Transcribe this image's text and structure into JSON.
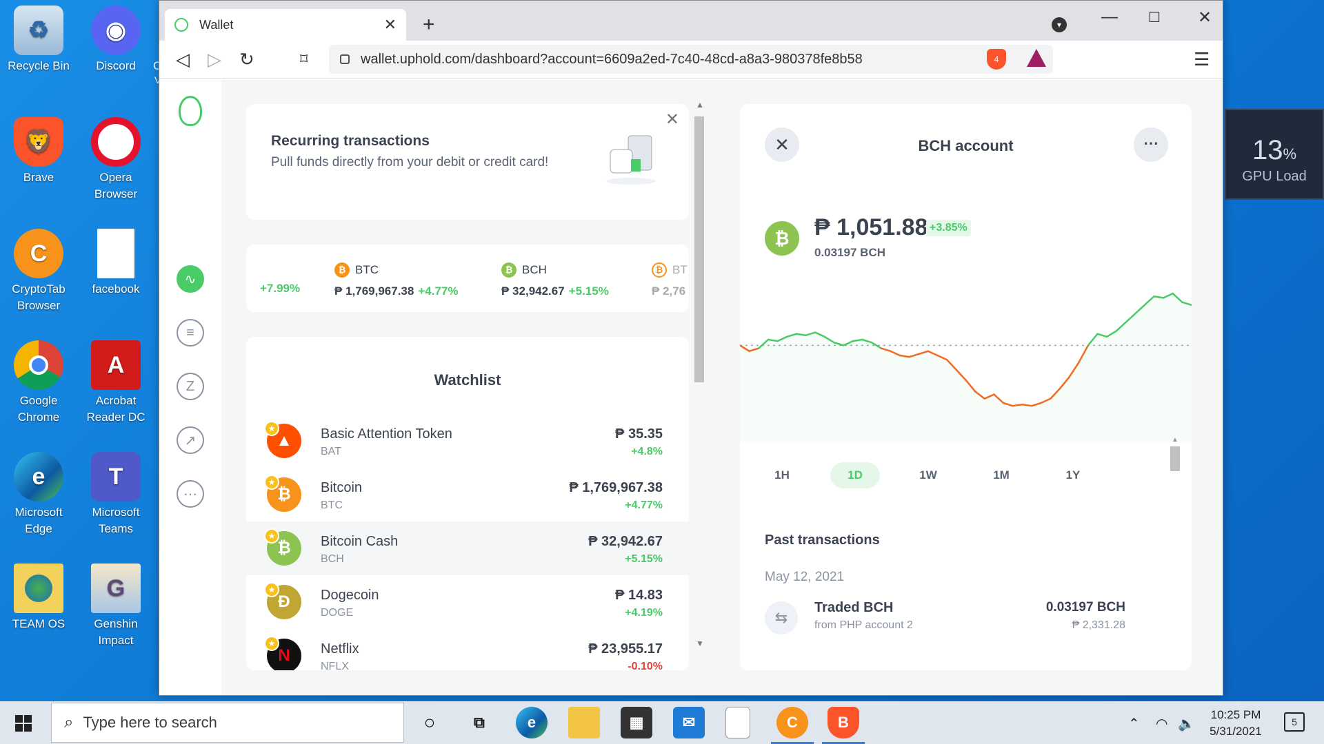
{
  "desktop": {
    "icons": [
      {
        "label": "Recycle Bin",
        "icon": "recycle-bin-icon"
      },
      {
        "label": "Discord",
        "icon": "discord-icon"
      },
      {
        "label": "Brave",
        "icon": "brave-icon"
      },
      {
        "label": "Opera\nBrowser",
        "icon": "opera-icon"
      },
      {
        "label": "CryptoTab\nBrowser",
        "icon": "cryptotab-icon"
      },
      {
        "label": "facebook",
        "icon": "file-icon"
      },
      {
        "label": "Google\nChrome",
        "icon": "chrome-icon"
      },
      {
        "label": "Acrobat\nReader DC",
        "icon": "acrobat-icon"
      },
      {
        "label": "Microsoft\nEdge",
        "icon": "edge-icon"
      },
      {
        "label": "Microsoft\nTeams",
        "icon": "teams-icon"
      },
      {
        "label": "TEAM OS",
        "icon": "team-os-icon"
      },
      {
        "label": "Genshin\nImpact",
        "icon": "genshin-icon"
      }
    ],
    "partial_label_1": "C",
    "partial_label_2": "V"
  },
  "gpu_widget": {
    "value": "13",
    "unit": "%",
    "label": "GPU Load"
  },
  "browser": {
    "tab_title": "Wallet",
    "url": "wallet.uphold.com/dashboard?account=6609a2ed-7c40-48cd-a8a3-980378fe8b58",
    "shield_count": "4"
  },
  "recurring": {
    "title": "Recurring transactions",
    "subtitle": "Pull funds directly from your debit or credit card!"
  },
  "ticker": [
    {
      "symbol": "",
      "price": "",
      "change": "+7.99%"
    },
    {
      "symbol": "BTC",
      "price": "₱ 1,769,967.38",
      "change": "+4.77%",
      "color": "#f7931a"
    },
    {
      "symbol": "BCH",
      "price": "₱ 32,942.67",
      "change": "+5.15%",
      "color": "#8dc351"
    },
    {
      "symbol": "BT",
      "price": "₱ 2,76",
      "change": "",
      "color": "#f7931a"
    }
  ],
  "watchlist": {
    "title": "Watchlist",
    "items": [
      {
        "name": "Basic Attention Token",
        "symbol": "BAT",
        "price": "₱ 35.35",
        "change": "+4.8%",
        "color": "#ff5000",
        "glyph": "▲"
      },
      {
        "name": "Bitcoin",
        "symbol": "BTC",
        "price": "₱ 1,769,967.38",
        "change": "+4.77%",
        "color": "#f7931a",
        "glyph": "₿"
      },
      {
        "name": "Bitcoin Cash",
        "symbol": "BCH",
        "price": "₱ 32,942.67",
        "change": "+5.15%",
        "color": "#8dc351",
        "glyph": "₿"
      },
      {
        "name": "Dogecoin",
        "symbol": "DOGE",
        "price": "₱ 14.83",
        "change": "+4.19%",
        "color": "#c2a633",
        "glyph": "Đ"
      },
      {
        "name": "Netflix",
        "symbol": "NFLX",
        "price": "₱ 23,955.17",
        "change": "-0.10%",
        "color": "#111111",
        "glyph": "N"
      }
    ]
  },
  "account": {
    "title": "BCH account",
    "balance": "₱ 1,051.88",
    "change": "+3.85%",
    "crypto_balance": "0.03197 BCH",
    "ranges": [
      "1H",
      "1D",
      "1W",
      "1M",
      "1Y"
    ],
    "active_range": "1D",
    "past_title": "Past transactions",
    "date": "May 12, 2021",
    "tx": {
      "title": "Traded BCH",
      "sub": "from PHP account 2",
      "amount": "0.03197 BCH",
      "fiat": "₱ 2,331.28"
    }
  },
  "chart_data": {
    "type": "line",
    "title": "",
    "xlabel": "",
    "ylabel": "",
    "reference_line": "dotted",
    "values": [
      62,
      58,
      60,
      66,
      65,
      68,
      70,
      69,
      71,
      68,
      64,
      62,
      65,
      66,
      64,
      60,
      58,
      55,
      54,
      56,
      58,
      55,
      52,
      45,
      38,
      30,
      25,
      28,
      22,
      20,
      21,
      20,
      22,
      25,
      32,
      40,
      50,
      62,
      70,
      68,
      72,
      78,
      84,
      90,
      96,
      95,
      98,
      92,
      90
    ],
    "line_color_above": "#49cc68",
    "line_color_below": "#f26b21"
  },
  "taskbar": {
    "search_placeholder": "Type here to search",
    "time": "10:25 PM",
    "date": "5/31/2021",
    "notification_count": "5"
  }
}
